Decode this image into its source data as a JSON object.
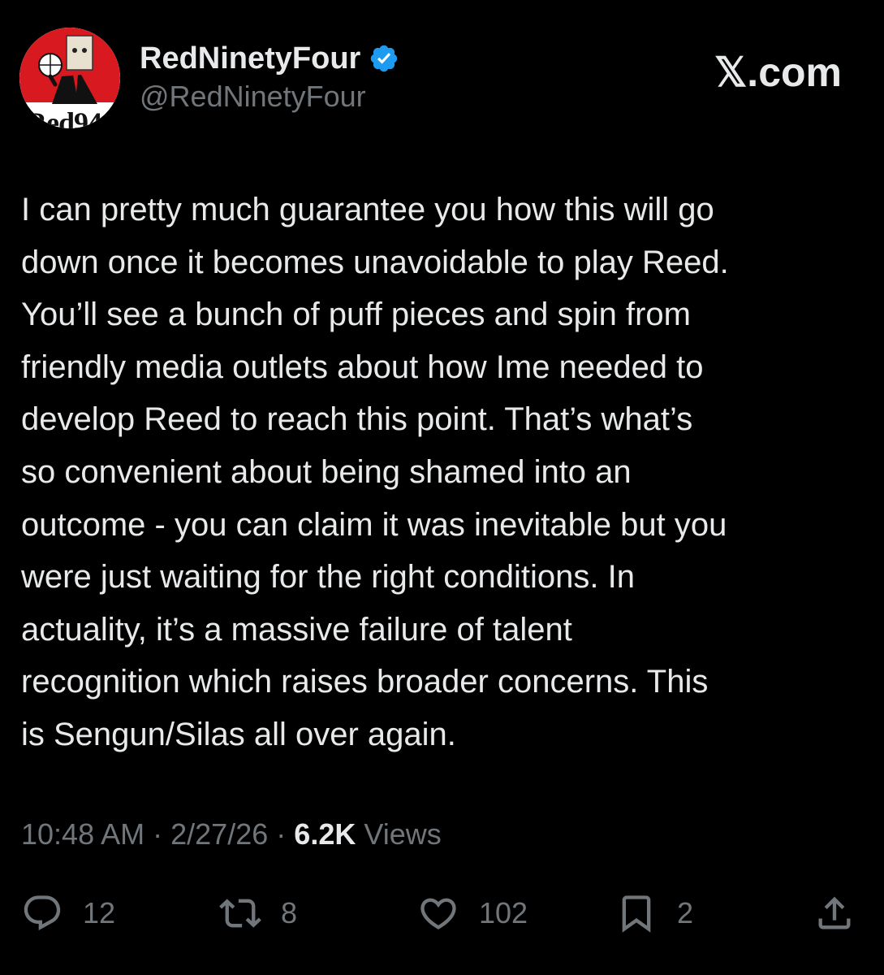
{
  "author": {
    "display_name": "RedNinetyFour",
    "handle": "@RedNinetyFour",
    "verified": true,
    "avatar_text": "Red94",
    "avatar_colors": {
      "background": "#d8191f",
      "figure": "#111111",
      "face": "#ffffff"
    }
  },
  "site_label": "𝕏.com",
  "tweet": {
    "lines": [
      "I can pretty much guarantee you how this will go",
      "down once it becomes unavoidable to play Reed.",
      "You’ll see a bunch of puff pieces and spin from",
      "friendly media outlets about how Ime needed to",
      "develop Reed to reach this point. That’s what’s",
      "so convenient about being shamed into an",
      "outcome - you can claim it was inevitable but you",
      "were just waiting for the right conditions. In",
      "actuality, it’s a massive failure of talent",
      "recognition which raises broader concerns. This",
      "is Sengun/Silas all over again."
    ]
  },
  "meta": {
    "time": "10:48 AM",
    "separator": "·",
    "date": "2/27/26",
    "views_count": "6.2K",
    "views_label": "Views"
  },
  "actions": {
    "replies": {
      "icon": "reply-icon",
      "count": "12"
    },
    "reposts": {
      "icon": "repost-icon",
      "count": "8"
    },
    "likes": {
      "icon": "like-icon",
      "count": "102"
    },
    "bookmarks": {
      "icon": "bookmark-icon",
      "count": "2"
    },
    "share": {
      "icon": "share-icon"
    }
  },
  "colors": {
    "background": "#000000",
    "text_primary": "#e7e9ea",
    "text_secondary": "#71767b",
    "verified_blue": "#1d9bf0"
  }
}
